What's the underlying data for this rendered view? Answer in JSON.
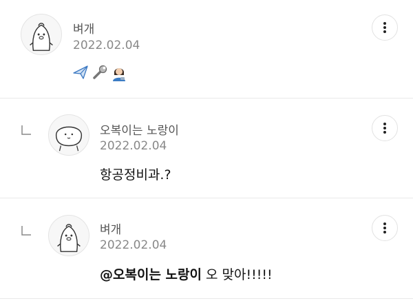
{
  "comments": [
    {
      "author": "벼개",
      "date": "2022.02.04",
      "avatar_icon": "bird-avatar-icon",
      "content_icons": [
        "airplane-icon",
        "wrench-icon",
        "woman-technician-icon"
      ]
    },
    {
      "author": "오복이는 노랑이",
      "date": "2022.02.04",
      "avatar_icon": "round-face-avatar-icon",
      "text": "항공정비과.?"
    },
    {
      "author": "벼개",
      "date": "2022.02.04",
      "avatar_icon": "bird-avatar-icon",
      "mention": "@오복이는 노랑이",
      "text": " 오 맞아!!!!!"
    }
  ],
  "colors": {
    "divider": "#e9e9e9",
    "author": "#555555",
    "date": "#888888",
    "text": "#111111"
  }
}
